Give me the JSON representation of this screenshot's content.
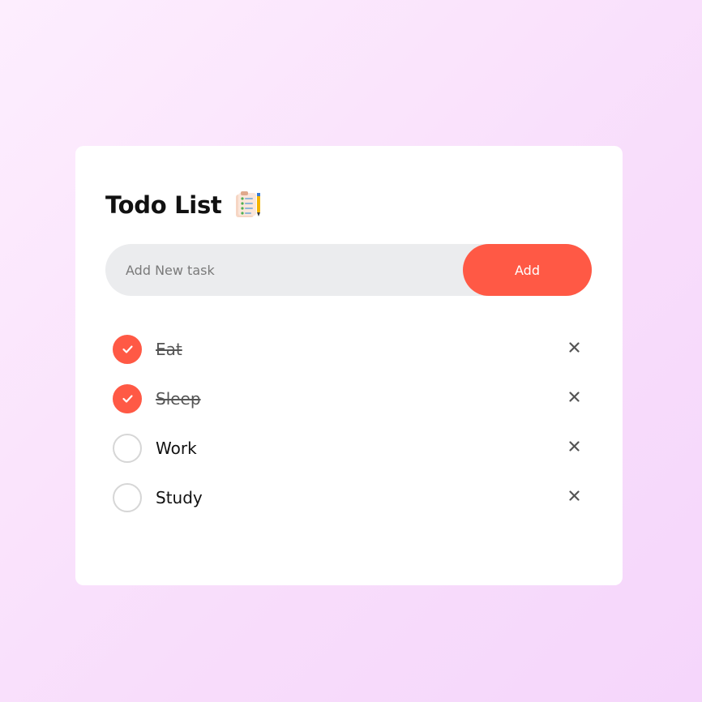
{
  "app": {
    "title": "Todo List",
    "title_icon": "clipboard-checklist-icon"
  },
  "new_task": {
    "placeholder": "Add New task",
    "value": "",
    "add_label": "Add"
  },
  "tasks": [
    {
      "label": "Eat",
      "done": true
    },
    {
      "label": "Sleep",
      "done": true
    },
    {
      "label": "Work",
      "done": false
    },
    {
      "label": "Study",
      "done": false
    }
  ],
  "icons": {
    "check": "checkmark-icon",
    "delete": "close-icon"
  },
  "colors": {
    "accent": "#ff5945",
    "input_bg": "#ebecee",
    "card_bg": "#ffffff",
    "page_bg": "#f8ddfb",
    "unchecked_border": "#d6d6d6"
  }
}
